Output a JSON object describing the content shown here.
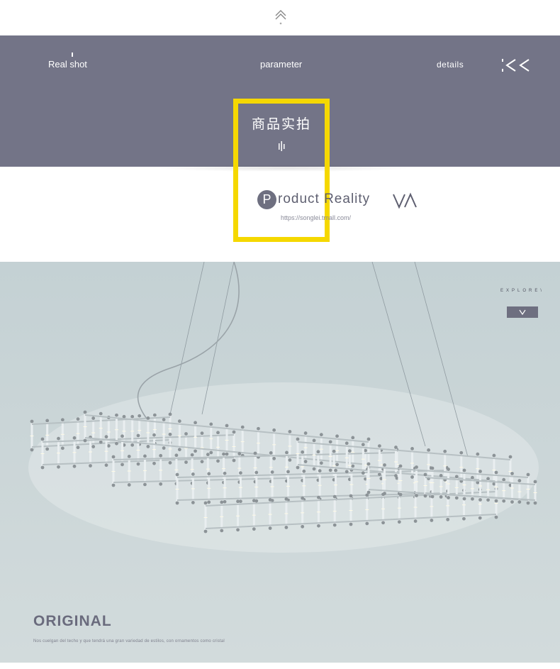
{
  "top": {
    "icon": "double-chevron-up-icon"
  },
  "nav": {
    "real_shot": "Real shot",
    "parameter": "parameter",
    "details": "details",
    "back_icon": "double-chevron-left-icon"
  },
  "section": {
    "title_cn": "商品实拍",
    "product_reality_letter": "P",
    "product_reality_rest": "roduct Reality",
    "url": "https://songlei.tmall.com/",
    "logo_text": "VA"
  },
  "photo": {
    "explore": "EXPLORE\\",
    "title": "ORIGINAL",
    "caption": "Nos cuelgan del techo y que tendrá una gran variedad de estilos, con ornamentos como cristal"
  },
  "colors": {
    "band": "#737487",
    "accent_yellow": "#f5d800",
    "text_gray": "#6a6b7d"
  }
}
